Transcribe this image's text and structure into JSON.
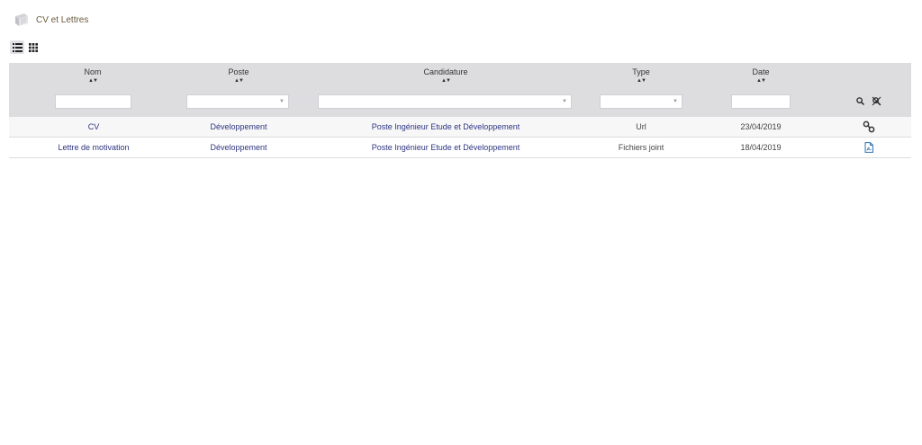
{
  "header": {
    "title": "CV et Lettres",
    "logo_icon": "documents-stack-icon"
  },
  "view_toggle": {
    "list_icon": "list-view-icon",
    "grid_icon": "grid-view-icon",
    "active": "list"
  },
  "table": {
    "columns": [
      {
        "key": "nom",
        "label": "Nom",
        "filter": "text"
      },
      {
        "key": "poste",
        "label": "Poste",
        "filter": "select"
      },
      {
        "key": "candidature",
        "label": "Candidature",
        "filter": "select"
      },
      {
        "key": "type",
        "label": "Type",
        "filter": "select"
      },
      {
        "key": "date",
        "label": "Date",
        "filter": "text"
      }
    ],
    "header_actions": {
      "search_icon": "search-icon",
      "clear_search_icon": "clear-search-icon"
    },
    "rows": [
      {
        "nom": "CV",
        "poste": "Développement",
        "candidature": "Poste Ingénieur Etude et Développement",
        "type": "Url",
        "date": "23/04/2019",
        "action_icon": "link-icon"
      },
      {
        "nom": "Lettre de motivation",
        "poste": "Développement",
        "candidature": "Poste Ingénieur Etude et Développement",
        "type": "Fichiers joint",
        "date": "18/04/2019",
        "action_icon": "pdf-file-icon"
      }
    ]
  },
  "colors": {
    "header_bg": "#dddde0",
    "link": "#2e3580",
    "title": "#6b5a3e"
  }
}
